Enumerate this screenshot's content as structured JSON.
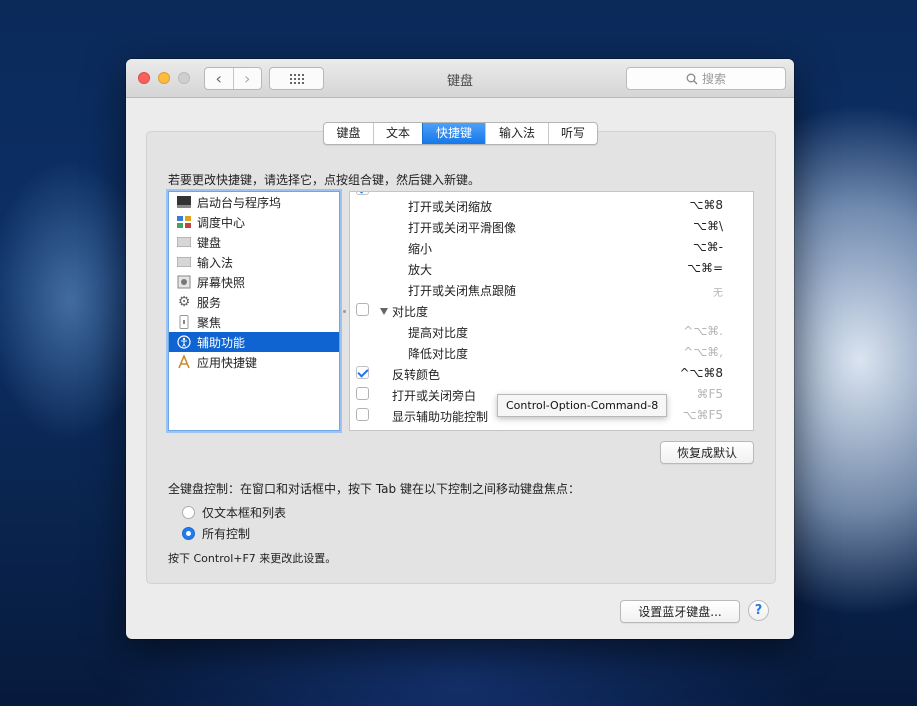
{
  "window": {
    "title": "键盘",
    "search_placeholder": "搜索"
  },
  "tabs": [
    {
      "label": "键盘",
      "active": false
    },
    {
      "label": "文本",
      "active": false
    },
    {
      "label": "快捷键",
      "active": true
    },
    {
      "label": "输入法",
      "active": false
    },
    {
      "label": "听写",
      "active": false
    }
  ],
  "instruction": "若要更改快捷键，请选择它，点按组合键，然后键入新键。",
  "categories": [
    {
      "label": "启动台与程序坞",
      "icon": "launchpad-dock-icon"
    },
    {
      "label": "调度中心",
      "icon": "mission-control-icon"
    },
    {
      "label": "键盘",
      "icon": "keyboard-icon"
    },
    {
      "label": "输入法",
      "icon": "input-method-icon"
    },
    {
      "label": "屏幕快照",
      "icon": "screenshot-icon"
    },
    {
      "label": "服务",
      "icon": "gear-icon"
    },
    {
      "label": "聚焦",
      "icon": "spotlight-icon"
    },
    {
      "label": "辅助功能",
      "icon": "accessibility-icon",
      "selected": true
    },
    {
      "label": "应用快捷键",
      "icon": "app-shortcuts-icon"
    }
  ],
  "shortcuts": [
    {
      "label": "打开或关闭缩放",
      "key": "⌥⌘8",
      "indent": 2,
      "checkbox": false
    },
    {
      "label": "打开或关闭平滑图像",
      "key": "⌥⌘\\",
      "indent": 2,
      "checkbox": false
    },
    {
      "label": "缩小",
      "key": "⌥⌘-",
      "indent": 2,
      "checkbox": false
    },
    {
      "label": "放大",
      "key": "⌥⌘=",
      "indent": 2,
      "checkbox": false
    },
    {
      "label": "打开或关闭焦点跟随",
      "key": "无",
      "indent": 2,
      "checkbox": false,
      "dim": true
    },
    {
      "label": "对比度",
      "key": "",
      "indent": 1,
      "checkbox": true,
      "checked": false,
      "group": true
    },
    {
      "label": "提高对比度",
      "key": "^⌥⌘.",
      "indent": 2,
      "checkbox": false,
      "dim": true
    },
    {
      "label": "降低对比度",
      "key": "^⌥⌘,",
      "indent": 2,
      "checkbox": false,
      "dim": true
    },
    {
      "label": "反转颜色",
      "key": "^⌥⌘8",
      "indent": 1,
      "checkbox": true,
      "checked": true
    },
    {
      "label": "打开或关闭旁白",
      "key": "⌘F5",
      "indent": 1,
      "checkbox": true,
      "checked": false,
      "dim": true
    },
    {
      "label": "显示辅助功能控制",
      "key": "⌥⌘F5",
      "indent": 1,
      "checkbox": true,
      "checked": false,
      "dim": true
    }
  ],
  "tooltip": "Control-Option-Command-8",
  "restore_defaults": "恢复成默认",
  "full_keyboard": {
    "label": "全键盘控制：在窗口和对话框中，按下 Tab 键在以下控制之间移动键盘焦点：",
    "options": [
      {
        "label": "仅文本框和列表",
        "selected": false
      },
      {
        "label": "所有控制",
        "selected": true
      }
    ],
    "hint": "按下 Control+F7 来更改此设置。"
  },
  "bluetooth_button": "设置蓝牙键盘...",
  "help_label": "?"
}
